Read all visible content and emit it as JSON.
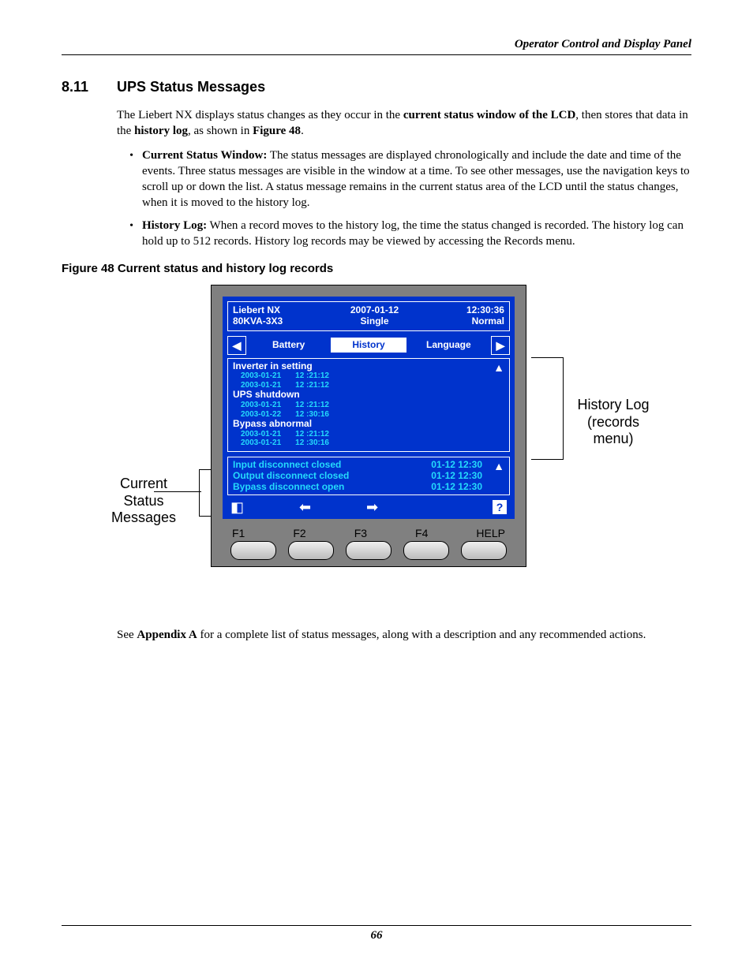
{
  "running_head": "Operator Control and Display Panel",
  "section": {
    "num": "8.11",
    "title": "UPS Status Messages"
  },
  "para1_a": "The Liebert NX displays status changes as they occur in the ",
  "para1_b": "current status window of the LCD",
  "para1_c": ", then stores that data in the ",
  "para1_d": "history log",
  "para1_e": ", as shown in ",
  "para1_f": "Figure 48",
  "para1_g": ".",
  "bullets": [
    {
      "lead": "Current Status Window:",
      "rest": " The status messages are displayed chronologically and include the date and time of the events. Three status messages are visible in the window at a time. To see other messages, use the navigation keys to scroll up or down the list. A status message remains in the current status area of the LCD until the status changes, when it is moved to the history log."
    },
    {
      "lead": "History Log:",
      "rest": " When a record moves to the history log, the time the status changed is recorded. The history log can hold up to 512 records. History log records may be viewed by accessing the Records menu."
    }
  ],
  "fig_caption": "Figure 48  Current status and history log records",
  "lcd": {
    "hdr": {
      "l1a": "Liebert NX",
      "l1b": "80KVA-3X3",
      "c1": "2007-01-12",
      "c2": "Single",
      "r1": "12:30:36",
      "r2": "Normal"
    },
    "tabs": {
      "t1": "Battery",
      "t2": "History",
      "t3": "Language"
    },
    "history": [
      {
        "title": "Inverter in setting",
        "rows": [
          [
            "2003-01-21",
            "12 :21:12"
          ],
          [
            "2003-01-21",
            "12 :21:12"
          ]
        ]
      },
      {
        "title": "UPS shutdown",
        "rows": [
          [
            "2003-01-21",
            "12 :21:12"
          ],
          [
            "2003-01-22",
            "12 :30:16"
          ]
        ]
      },
      {
        "title": "Bypass abnormal",
        "rows": [
          [
            "2003-01-21",
            "12 :21:12"
          ],
          [
            "2003-01-21",
            "12 :30:16"
          ]
        ]
      }
    ],
    "status": [
      {
        "m": "Input disconnect closed",
        "t": "01-12 12:30"
      },
      {
        "m": "Output disconnect closed",
        "t": "01-12 12:30"
      },
      {
        "m": "Bypass disconnect open",
        "t": "01-12 12:30"
      }
    ],
    "btns": {
      "f1": "F1",
      "f2": "F2",
      "f3": "F3",
      "f4": "F4",
      "help": "HELP"
    }
  },
  "ann": {
    "left_l1": "Current",
    "left_l2": "Status",
    "left_l3": "Messages",
    "right_l1": "History Log",
    "right_l2": "(records",
    "right_l3": "menu)"
  },
  "para2_a": "See ",
  "para2_b": "Appendix A",
  "para2_c": " for a complete list of status messages, along with a description and any recommended actions.",
  "page_num": "66"
}
